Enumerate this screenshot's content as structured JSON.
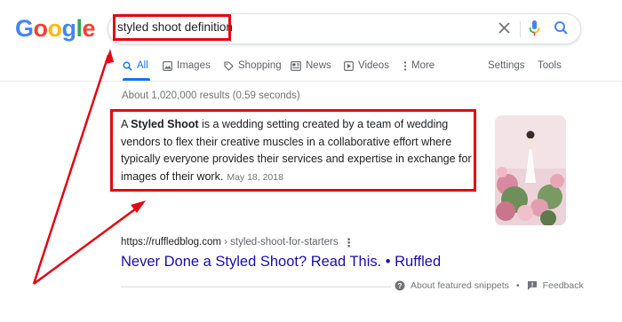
{
  "logo": {
    "letters": [
      "G",
      "o",
      "o",
      "g",
      "l",
      "e"
    ],
    "colors": [
      "#4285F4",
      "#EA4335",
      "#FBBC05",
      "#4285F4",
      "#34A853",
      "#EA4335"
    ]
  },
  "search": {
    "query": "styled shoot definition",
    "clear_icon": "close-icon",
    "mic_icon": "mic-icon",
    "search_icon": "search-icon"
  },
  "tabs": {
    "all": "All",
    "images": "Images",
    "shopping": "Shopping",
    "news": "News",
    "videos": "Videos",
    "more": "More",
    "settings": "Settings",
    "tools": "Tools"
  },
  "stats": "About 1,020,000 results (0.59 seconds)",
  "snippet": {
    "pre": "A ",
    "bold": "Styled Shoot",
    "rest": " is a wedding setting created by a team of wedding vendors to flex their creative muscles in a collaborative effort where typically everyone provides their services and expertise in exchange for images of their work.",
    "date": "May 18, 2018"
  },
  "result": {
    "url": "https://ruffledblog.com",
    "breadcrumb": " › styled-shoot-for-starters",
    "title": "Never Done a Styled Shoot? Read This. • Ruffled"
  },
  "footer": {
    "about": "About featured snippets",
    "dot": "•",
    "feedback": "Feedback"
  },
  "colors": {
    "accent": "#1a73e8",
    "link": "#1a0dab",
    "annotation": "#e30613"
  }
}
